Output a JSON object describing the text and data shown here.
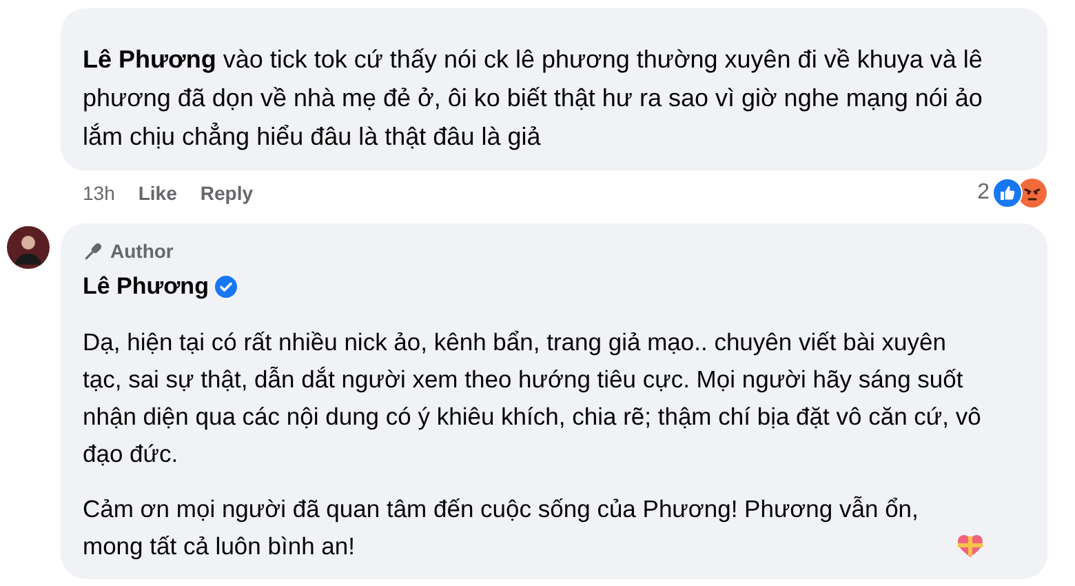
{
  "comments": [
    {
      "kind": "reply",
      "text": "**Lê Phương** vào tick tok cứ thấy nói ck lê phương thường xuyên đi về khuya và lê phương đã dọn về nhà mẹ đẻ ở, ôi ko biết thật hư ra sao vì giờ nghe mạng nói ảo lắm chịu chẳng hiểu đâu là thật đâu là giả",
      "time": "13h",
      "actions": [
        "Like",
        "Reply"
      ],
      "reaction_count": "2"
    },
    {
      "kind": "author",
      "badge": "Author",
      "author": "Lê Phương",
      "verified": true,
      "paragraphs": [
        "Dạ, hiện tại có rất nhiều nick ảo, kênh bẩn, trang giả mạo.. chuyên viết bài xuyên tạc, sai sự thật, dẫn dắt người xem theo hướng tiêu cực. Mọi người hãy sáng suốt nhận diện qua các nội dung có ý khiêu khích, chia rẽ; thậm chí bịa đặt vô căn cứ, vô đạo đức.",
        "Cảm ơn mọi người đã quan tâm đến cuộc sống của Phương! Phương vẫn ổn, mong tất cả luôn bình an!"
      ]
    }
  ]
}
